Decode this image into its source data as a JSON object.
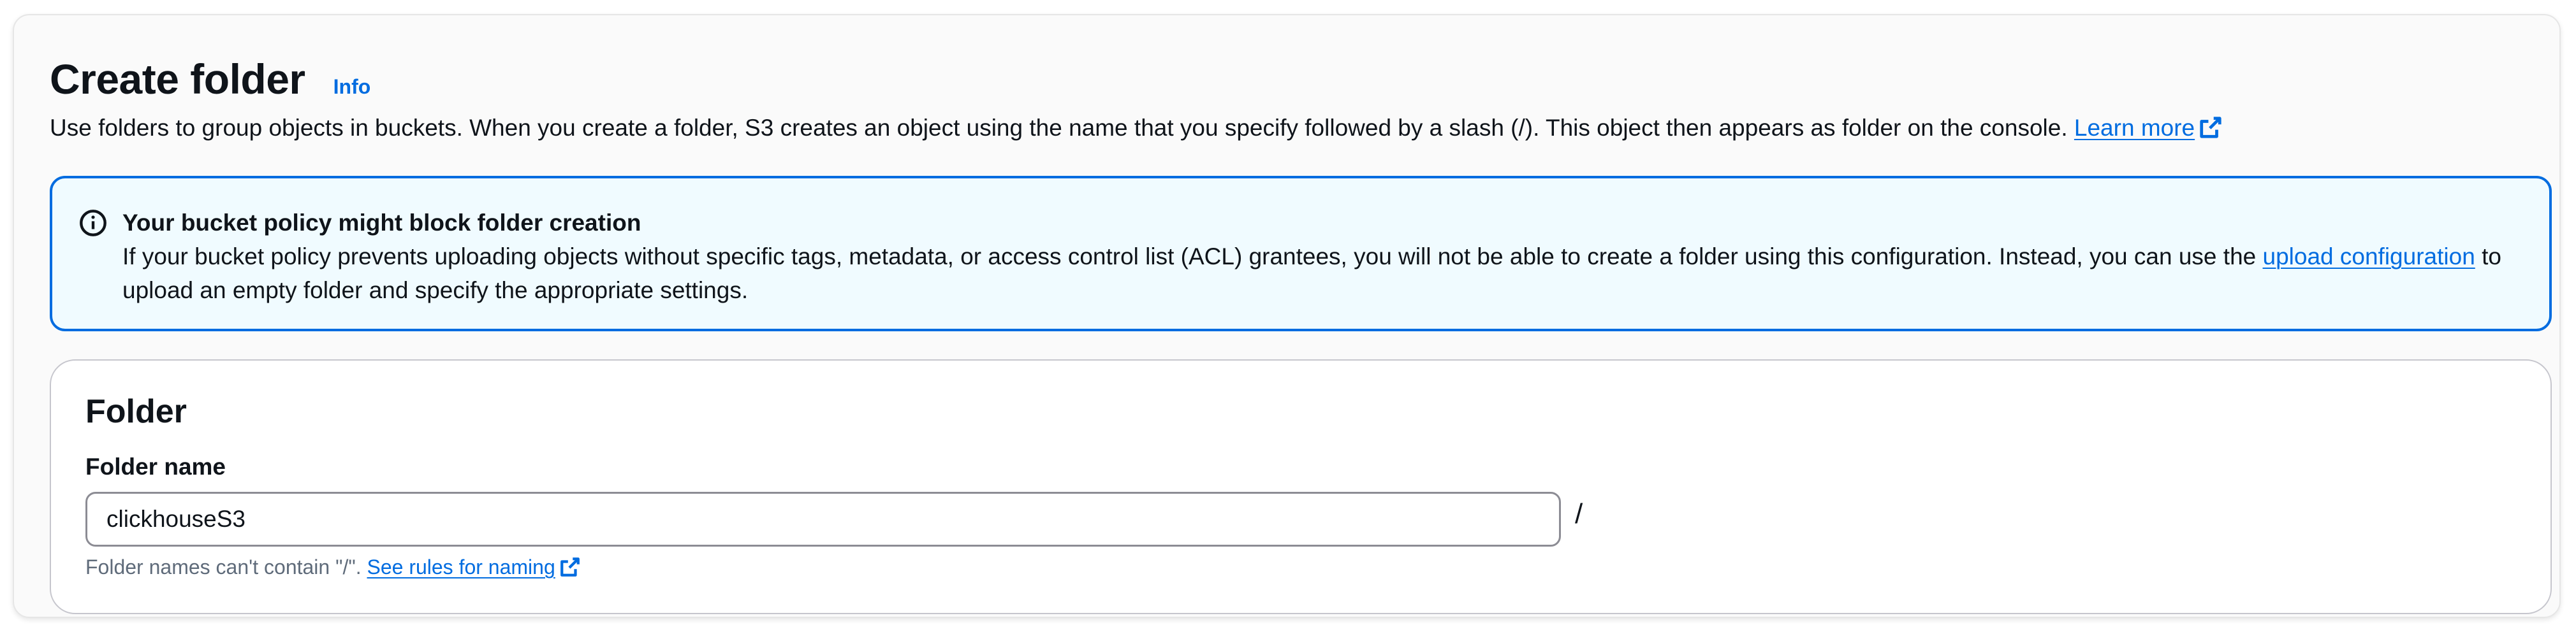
{
  "header": {
    "title": "Create folder",
    "info_label": "Info",
    "description": "Use folders to group objects in buckets. When you create a folder, S3 creates an object using the name that you specify followed by a slash (/). This object then appears as folder on the console.",
    "learn_more_label": "Learn more"
  },
  "alert": {
    "title": "Your bucket policy might block folder creation",
    "text_before": "If your bucket policy prevents uploading objects without specific tags, metadata, or access control list (ACL) grantees, you will not be able to create a folder using this configuration. Instead, you can use the",
    "link_label": "upload configuration",
    "text_after": "to upload an empty folder and specify the appropriate settings.",
    "icon": "info-circle-icon",
    "border_color": "#006ce0",
    "background_color": "#f0fbff"
  },
  "folder": {
    "heading": "Folder",
    "name_label": "Folder name",
    "name_value": "clickhouseS3",
    "suffix": "/",
    "hint_text": "Folder names can't contain \"/\".",
    "hint_link_label": "See rules for naming"
  },
  "colors": {
    "link": "#006ce0",
    "text": "#0f141a",
    "hint_text": "#5f6b7a"
  }
}
